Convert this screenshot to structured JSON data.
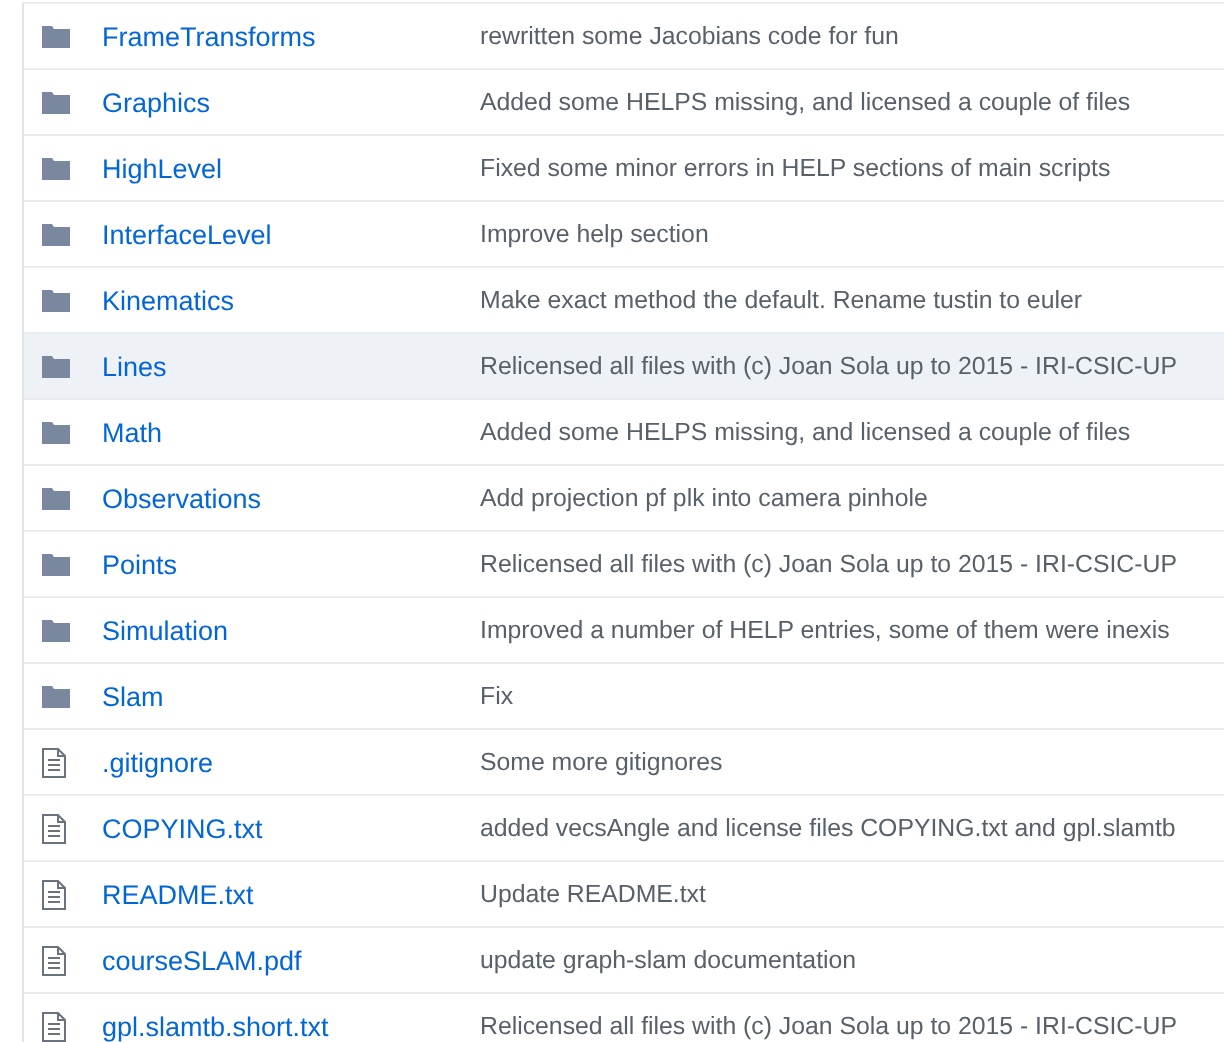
{
  "files": [
    {
      "kind": "folder",
      "name": "FrameTransforms",
      "message": "rewritten some Jacobians code for fun",
      "highlighted": false
    },
    {
      "kind": "folder",
      "name": "Graphics",
      "message": "Added some HELPS missing, and licensed a couple of files",
      "highlighted": false
    },
    {
      "kind": "folder",
      "name": "HighLevel",
      "message": "Fixed some minor errors in HELP sections of main scripts",
      "highlighted": false
    },
    {
      "kind": "folder",
      "name": "InterfaceLevel",
      "message": "Improve help section",
      "highlighted": false
    },
    {
      "kind": "folder",
      "name": "Kinematics",
      "message": "Make exact method the default. Rename tustin to euler",
      "highlighted": false
    },
    {
      "kind": "folder",
      "name": "Lines",
      "message": "Relicensed all files with (c) Joan Sola up to 2015 - IRI-CSIC-UP",
      "highlighted": true
    },
    {
      "kind": "folder",
      "name": "Math",
      "message": "Added some HELPS missing, and licensed a couple of files",
      "highlighted": false
    },
    {
      "kind": "folder",
      "name": "Observations",
      "message": "Add projection pf plk into camera pinhole",
      "highlighted": false
    },
    {
      "kind": "folder",
      "name": "Points",
      "message": "Relicensed all files with (c) Joan Sola up to 2015 - IRI-CSIC-UP",
      "highlighted": false
    },
    {
      "kind": "folder",
      "name": "Simulation",
      "message": "Improved a number of HELP entries, some of them were inexis",
      "highlighted": false
    },
    {
      "kind": "folder",
      "name": "Slam",
      "message": "Fix",
      "highlighted": false
    },
    {
      "kind": "file",
      "name": ".gitignore",
      "message": "Some more gitignores",
      "highlighted": false
    },
    {
      "kind": "file",
      "name": "COPYING.txt",
      "message": "added vecsAngle and license files COPYING.txt and gpl.slamtb",
      "highlighted": false
    },
    {
      "kind": "file",
      "name": "README.txt",
      "message": "Update README.txt",
      "highlighted": false
    },
    {
      "kind": "file",
      "name": "courseSLAM.pdf",
      "message": "update graph-slam documentation",
      "highlighted": false
    },
    {
      "kind": "file",
      "name": "gpl.slamtb.short.txt",
      "message": "Relicensed all files with (c) Joan Sola up to 2015 - IRI-CSIC-UP",
      "highlighted": false
    }
  ]
}
